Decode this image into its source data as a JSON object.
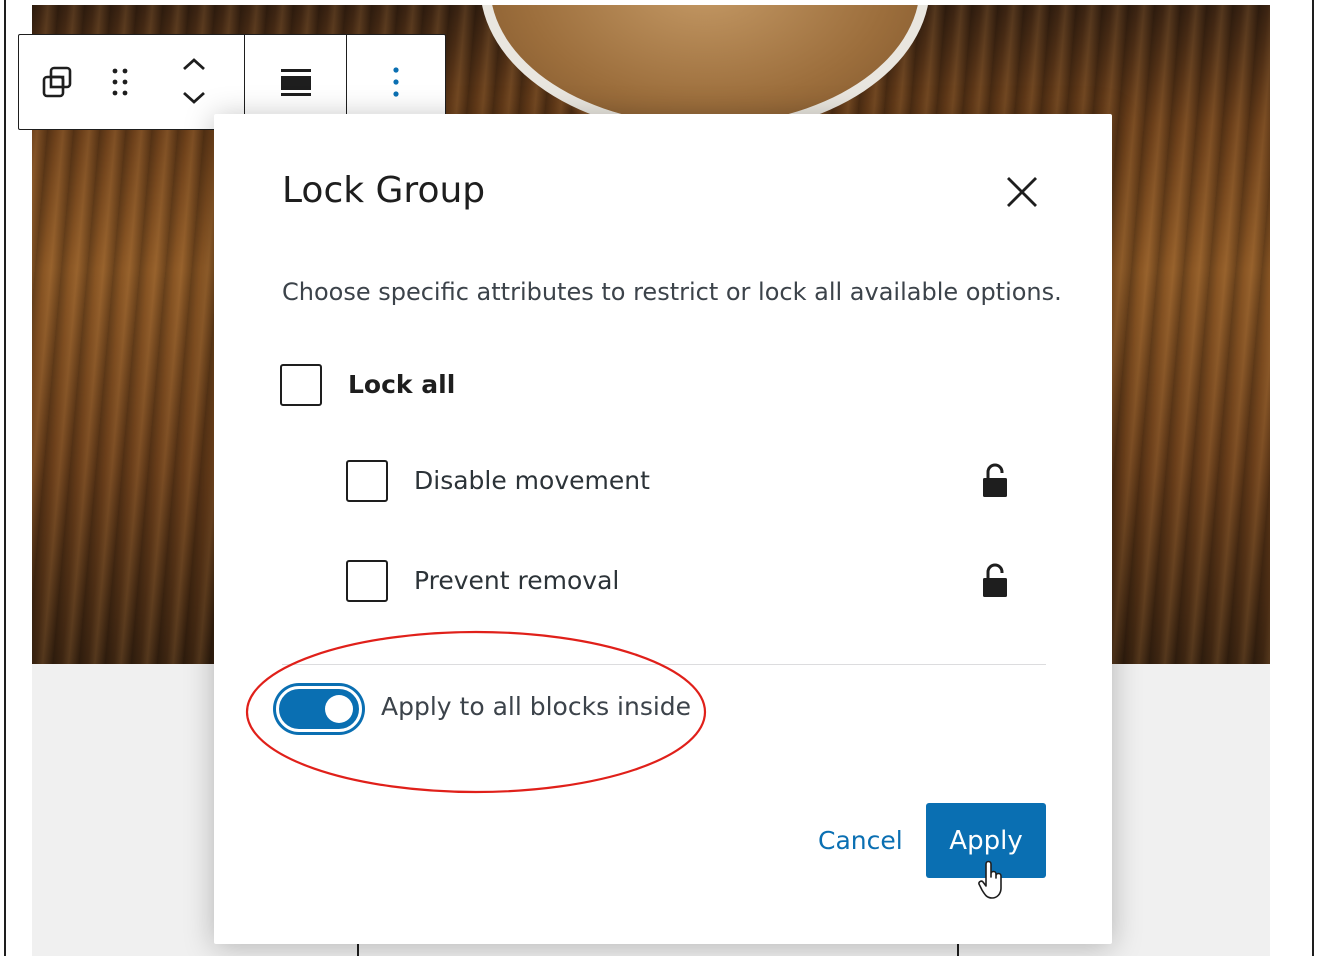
{
  "toolbar": {
    "icons": [
      "duplicate-icon",
      "drag-handle-icon",
      "move-up-down-icon",
      "align-icon",
      "more-options-icon"
    ]
  },
  "modal": {
    "title": "Lock Group",
    "description": "Choose specific attributes to restrict or lock all available options.",
    "lock_all_label": "Lock all",
    "options": [
      {
        "label": "Disable movement",
        "checked": false,
        "icon": "unlock-icon"
      },
      {
        "label": "Prevent removal",
        "checked": false,
        "icon": "unlock-icon"
      }
    ],
    "toggle": {
      "label": "Apply to all blocks inside",
      "on": true
    },
    "cancel_label": "Cancel",
    "apply_label": "Apply"
  },
  "colors": {
    "accent": "#0a6fb2",
    "annotation": "#e0201a",
    "text": "#1e1e1e"
  }
}
